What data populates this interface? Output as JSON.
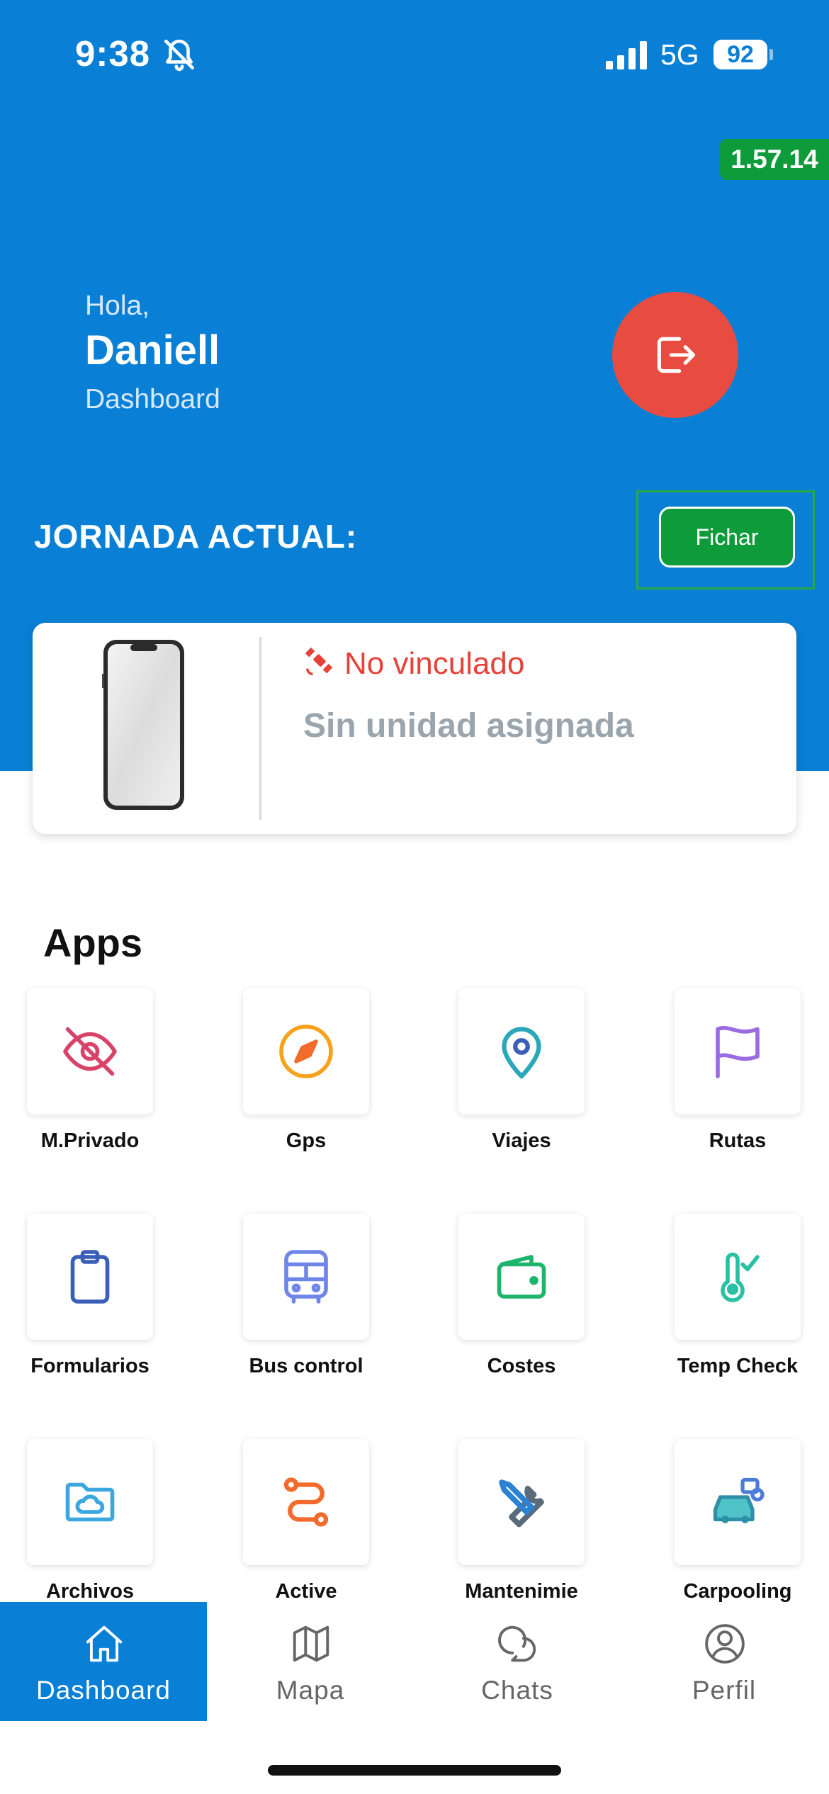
{
  "status_bar": {
    "time": "9:38",
    "network": "5G",
    "battery": "92"
  },
  "version_badge": "1.57.14",
  "header": {
    "greeting": "Hola,",
    "user_name": "Daniell",
    "subtitle": "Dashboard"
  },
  "shift": {
    "title": "JORNADA ACTUAL:",
    "clock_button": "Fichar"
  },
  "device_card": {
    "status": "No vinculado",
    "unit": "Sin unidad asignada"
  },
  "apps": {
    "title": "Apps",
    "items": [
      {
        "label": "M.Privado",
        "icon": "eye-off-icon"
      },
      {
        "label": "Gps",
        "icon": "compass-icon"
      },
      {
        "label": "Viajes",
        "icon": "map-pin-icon"
      },
      {
        "label": "Rutas",
        "icon": "flag-icon"
      },
      {
        "label": "Formularios",
        "icon": "clipboard-icon"
      },
      {
        "label": "Bus control",
        "icon": "bus-icon"
      },
      {
        "label": "Costes",
        "icon": "wallet-icon"
      },
      {
        "label": "Temp Check",
        "icon": "thermometer-icon"
      },
      {
        "label": "Archivos",
        "icon": "cloud-folder-icon"
      },
      {
        "label": "Active",
        "icon": "route-icon"
      },
      {
        "label": "Mantenimie",
        "icon": "tools-icon"
      },
      {
        "label": "Carpooling",
        "icon": "car-icon"
      }
    ]
  },
  "nav": {
    "items": [
      {
        "label": "Dashboard",
        "icon": "home-icon",
        "active": true
      },
      {
        "label": "Mapa",
        "icon": "map-icon",
        "active": false
      },
      {
        "label": "Chats",
        "icon": "chat-icon",
        "active": false
      },
      {
        "label": "Perfil",
        "icon": "user-icon",
        "active": false
      }
    ]
  },
  "colors": {
    "primary": "#0980D5",
    "accent_green": "#0E9C3A",
    "logout_red": "#E84B3F",
    "status_red": "#E5433A",
    "muted_grey": "#9AA5AD"
  }
}
